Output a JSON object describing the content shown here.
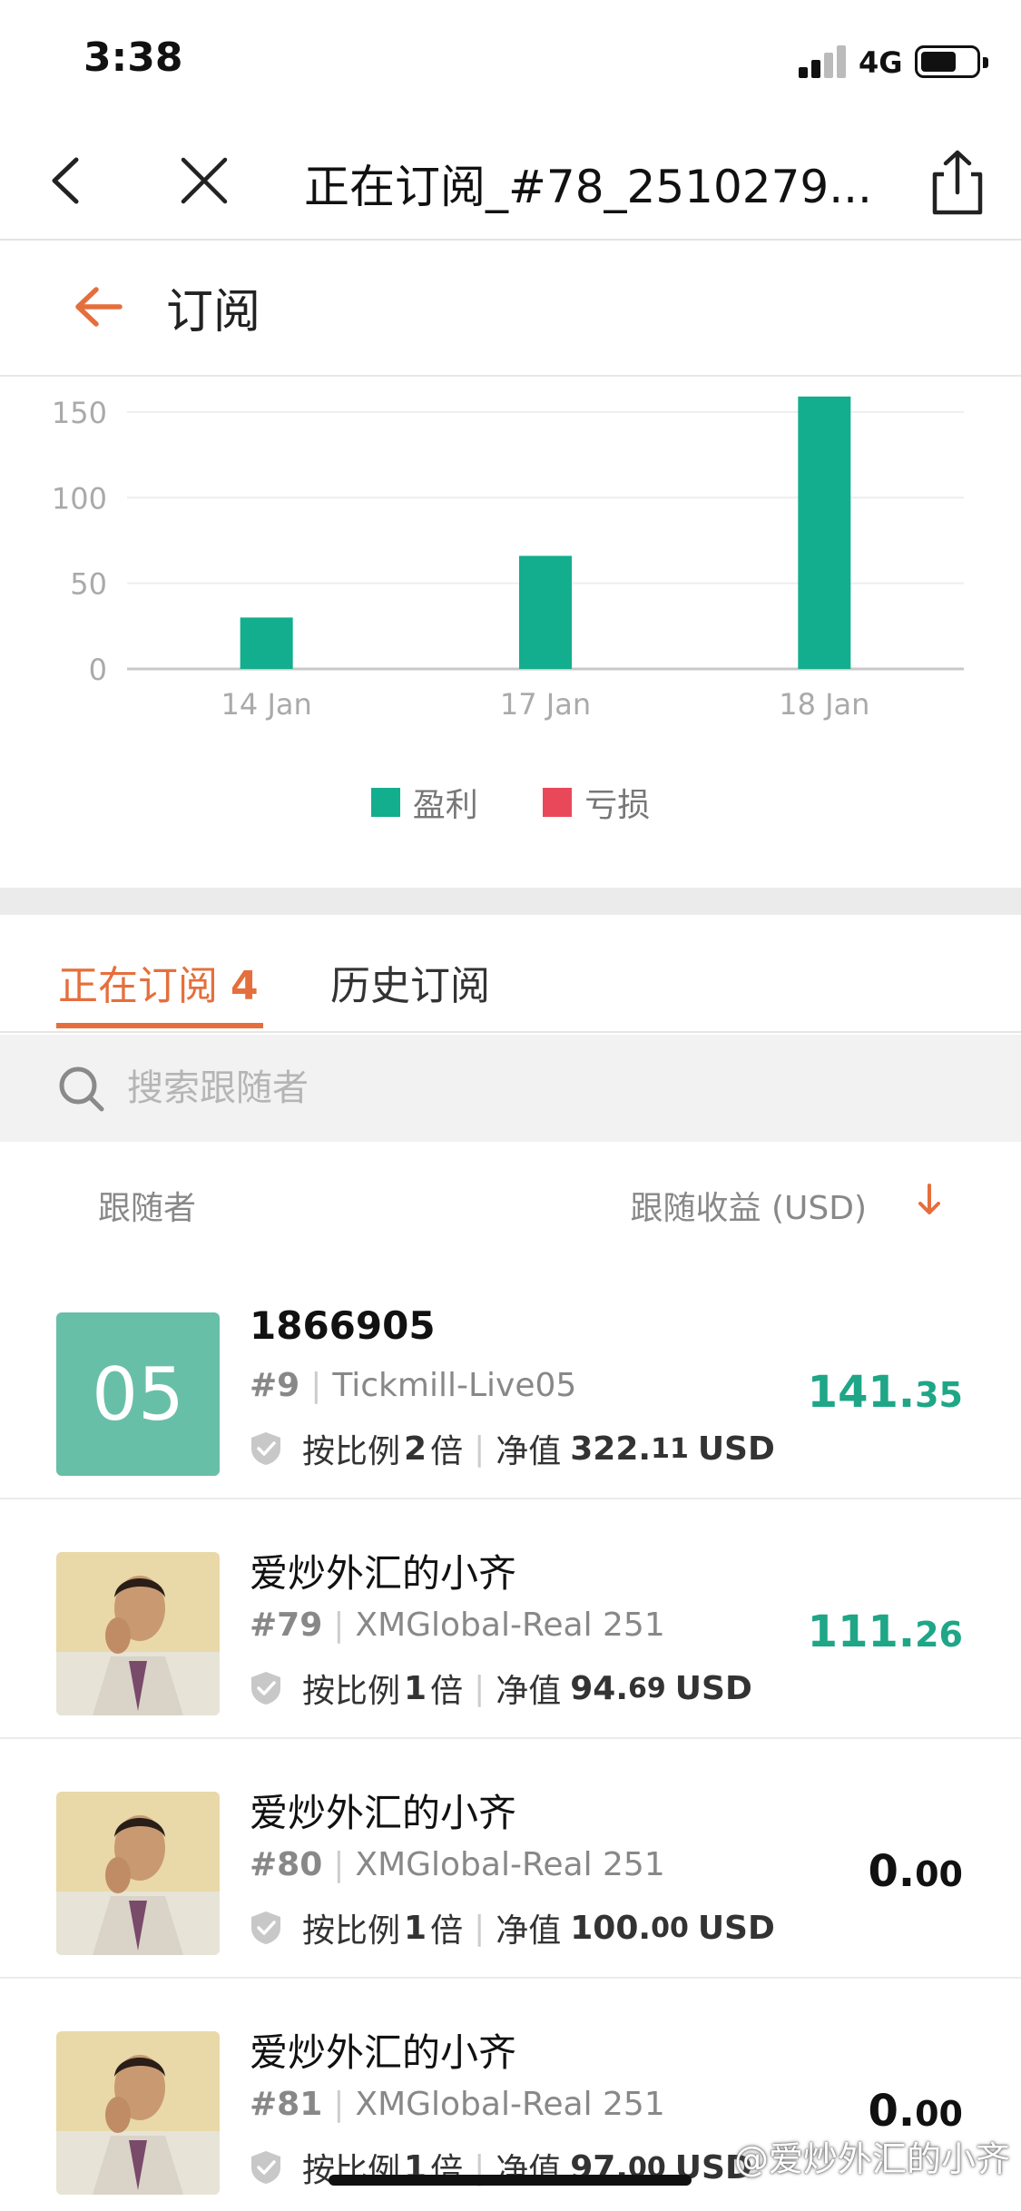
{
  "status": {
    "time": "3:38",
    "network": "4G"
  },
  "topbar": {
    "title": "正在订阅_#78_2510279..."
  },
  "header": {
    "title": "订阅"
  },
  "chart_data": {
    "type": "bar",
    "categories": [
      "14 Jan",
      "17 Jan",
      "18 Jan"
    ],
    "series": [
      {
        "name": "盈利",
        "color": "#13ae8e",
        "values": [
          30,
          66,
          159
        ]
      },
      {
        "name": "亏损",
        "color": "#e9485a",
        "values": [
          0,
          0,
          0
        ]
      }
    ],
    "yticks": [
      "0",
      "50",
      "100",
      "150"
    ],
    "ylim": [
      0,
      160
    ],
    "grid": true,
    "legend": "bottom"
  },
  "tabs": {
    "active_label": "正在订阅",
    "active_count": "4",
    "history_label": "历史订阅"
  },
  "search": {
    "placeholder": "搜索跟随者"
  },
  "list_header": {
    "left": "跟随者",
    "right": "跟随收益 (USD)"
  },
  "rows": [
    {
      "avatar_text": "05",
      "name": "1866905",
      "id": "#9",
      "broker": "Tickmill-Live05",
      "ratio_pre": "按比例",
      "ratio": "2",
      "ratio_post": "倍",
      "equity_label": "净值",
      "equity_int": "322.",
      "equity_dec": "11",
      "currency": "USD",
      "profit_int": "141.",
      "profit_dec": "35"
    },
    {
      "name": "爱炒外汇的小齐",
      "id": "#79",
      "broker": "XMGlobal-Real 251",
      "ratio_pre": "按比例",
      "ratio": "1",
      "ratio_post": "倍",
      "equity_label": "净值",
      "equity_int": "94.",
      "equity_dec": "69",
      "currency": "USD",
      "profit_int": "111.",
      "profit_dec": "26"
    },
    {
      "name": "爱炒外汇的小齐",
      "id": "#80",
      "broker": "XMGlobal-Real 251",
      "ratio_pre": "按比例",
      "ratio": "1",
      "ratio_post": "倍",
      "equity_label": "净值",
      "equity_int": "100.",
      "equity_dec": "00",
      "currency": "USD",
      "profit_int": "0.",
      "profit_dec": "00"
    },
    {
      "name": "爱炒外汇的小齐",
      "id": "#81",
      "broker": "XMGlobal-Real 251",
      "ratio_pre": "按比例",
      "ratio": "1",
      "ratio_post": "倍",
      "equity_label": "净值",
      "equity_int": "97.",
      "equity_dec": "00",
      "currency": "USD",
      "profit_int": "0.",
      "profit_dec": "00"
    }
  ],
  "watermark": "@爱炒外汇的小齐"
}
